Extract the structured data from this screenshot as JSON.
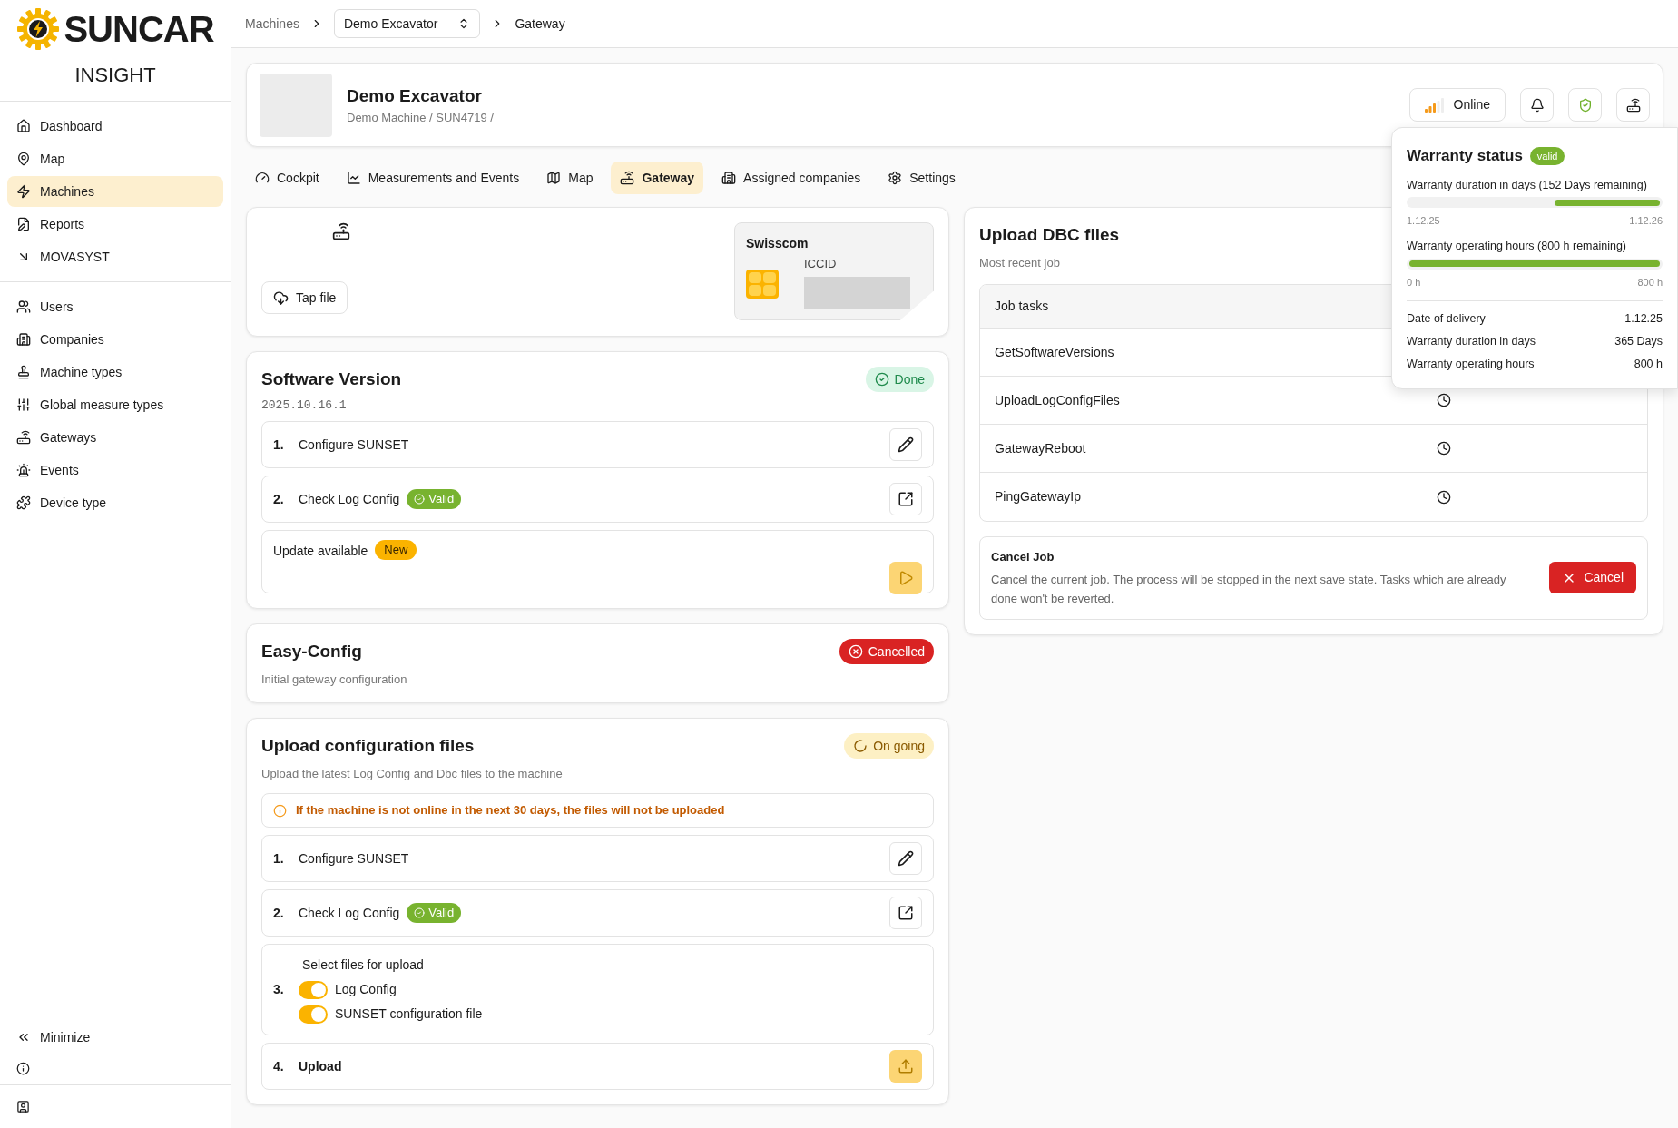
{
  "sidebar": {
    "brand": "SUNCAR",
    "product": "INSIGHT",
    "groups": [
      [
        {
          "label": "Dashboard",
          "selected": false
        },
        {
          "label": "Map",
          "selected": false
        },
        {
          "label": "Machines",
          "selected": true
        },
        {
          "label": "Reports",
          "selected": false
        },
        {
          "label": "MOVASYST",
          "selected": false
        }
      ],
      [
        {
          "label": "Users",
          "selected": false
        },
        {
          "label": "Companies",
          "selected": false
        },
        {
          "label": "Machine types",
          "selected": false
        },
        {
          "label": "Global measure types",
          "selected": false
        },
        {
          "label": "Gateways",
          "selected": false
        },
        {
          "label": "Events",
          "selected": false
        },
        {
          "label": "Device type",
          "selected": false
        }
      ]
    ],
    "minimize": "Minimize"
  },
  "breadcrumb": {
    "root": "Machines",
    "machine_select": "Demo Excavator",
    "current": "Gateway"
  },
  "machine": {
    "name": "Demo Excavator",
    "subtitle": "Demo Machine / SUN4719 /",
    "status": "Online"
  },
  "tabs": [
    {
      "label": "Cockpit",
      "selected": false
    },
    {
      "label": "Measurements and Events",
      "selected": false
    },
    {
      "label": "Map",
      "selected": false
    },
    {
      "label": "Gateway",
      "selected": true
    },
    {
      "label": "Assigned companies",
      "selected": false
    },
    {
      "label": "Settings",
      "selected": false
    }
  ],
  "gateway": {
    "tap_file": "Tap file",
    "sim": {
      "provider": "Swisscom",
      "iccid_label": "ICCID"
    }
  },
  "software_version": {
    "title": "Software Version",
    "version": "2025.10.16.1",
    "status": {
      "kind": "done",
      "label": "Done"
    },
    "steps": [
      {
        "kind": "edit",
        "number": "1.",
        "label": "Configure SUNSET"
      },
      {
        "kind": "open",
        "number": "2.",
        "label": "Check Log Config",
        "badge": "Valid"
      },
      {
        "kind": "update",
        "label": "Update available",
        "badge": "New"
      }
    ]
  },
  "easy_config": {
    "title": "Easy-Config",
    "subtitle": "Initial gateway configuration",
    "status": {
      "kind": "cancelled",
      "label": "Cancelled"
    }
  },
  "upload_config": {
    "title": "Upload configuration files",
    "subtitle": "Upload the latest Log Config and Dbc files to the machine",
    "status": {
      "kind": "ongoing",
      "label": "On going"
    },
    "warning": "If the machine is not online in the next 30 days, the files will not be uploaded",
    "steps": [
      {
        "kind": "edit",
        "number": "1.",
        "label": "Configure SUNSET"
      },
      {
        "kind": "open",
        "number": "2.",
        "label": "Check Log Config",
        "badge": "Valid"
      },
      {
        "kind": "toggles",
        "number": "3.",
        "label": "Select files for upload",
        "toggles": [
          {
            "label": "Log Config",
            "on": true
          },
          {
            "label": "SUNSET configuration file",
            "on": true
          }
        ]
      },
      {
        "kind": "upload",
        "number": "4.",
        "label": "Upload"
      }
    ]
  },
  "upload_dbc": {
    "title": "Upload DBC files",
    "subtitle": "Most recent job",
    "table_header": "Job tasks",
    "rows": [
      {
        "task": "GetSoftwareVersions"
      },
      {
        "task": "UploadLogConfigFiles",
        "kind": "pending"
      },
      {
        "task": "GatewayReboot",
        "kind": "pending"
      },
      {
        "task": "PingGatewayIp",
        "kind": "pending"
      }
    ],
    "cancel_job": {
      "title": "Cancel Job",
      "text": "Cancel the current job. The process will be stopped in the next save state. Tasks which are already done won't be reverted.",
      "button": "Cancel"
    }
  },
  "warranty": {
    "title": "Warranty status",
    "badge": "valid",
    "bars": [
      {
        "label": "Warranty duration in days (152 Days remaining)",
        "level": 0.42,
        "start": "1.12.25",
        "end": "1.12.26"
      },
      {
        "label": "Warranty operating hours (800 h remaining)",
        "level": 1,
        "start": "0 h",
        "end": "800 h"
      }
    ],
    "details": [
      {
        "label": "Date of delivery",
        "value": "1.12.25"
      },
      {
        "label": "Warranty duration in days",
        "value": "365 Days"
      },
      {
        "label": "Warranty operating hours",
        "value": "800 h"
      }
    ]
  }
}
